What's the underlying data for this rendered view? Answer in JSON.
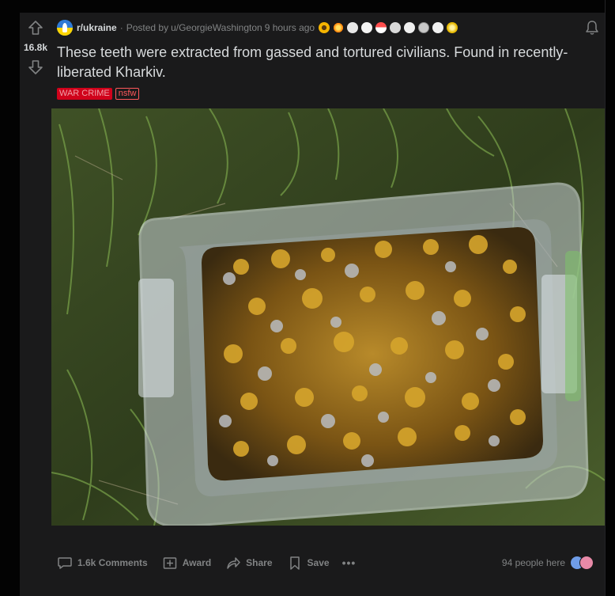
{
  "post": {
    "subreddit": "r/ukraine",
    "posted_by_prefix": "Posted by",
    "author": "u/GeorgieWashington",
    "time": "9 hours ago",
    "score": "16.8k",
    "title": "These teeth were extracted from gassed and tortured civilians. Found in recently-liberated Kharkiv.",
    "flairs": {
      "war_crime": "WAR CRIME",
      "nsfw": "nsfw"
    },
    "awards": [
      "sunflower-award-icon",
      "sparkle-award-icon",
      "eyes-award-icon",
      "laughing-award-icon",
      "cake-award-icon",
      "wholesome-award-icon",
      "helpful-award-icon",
      "silver-award-icon",
      "bear-award-icon",
      "gold-award-icon"
    ]
  },
  "image": {
    "alt": "Plastic container filled with gold and silver teeth on grass"
  },
  "footer": {
    "comments_label": "1.6k Comments",
    "award_label": "Award",
    "share_label": "Share",
    "save_label": "Save",
    "more_label": "•••",
    "people_here": "94 people here"
  },
  "colors": {
    "card_bg": "#1a1a1b",
    "page_bg": "#030303",
    "text_primary": "#d7dadc",
    "text_muted": "#818384",
    "flair_war_crime": "#d0021b",
    "flair_nsfw": "#ff585b"
  }
}
